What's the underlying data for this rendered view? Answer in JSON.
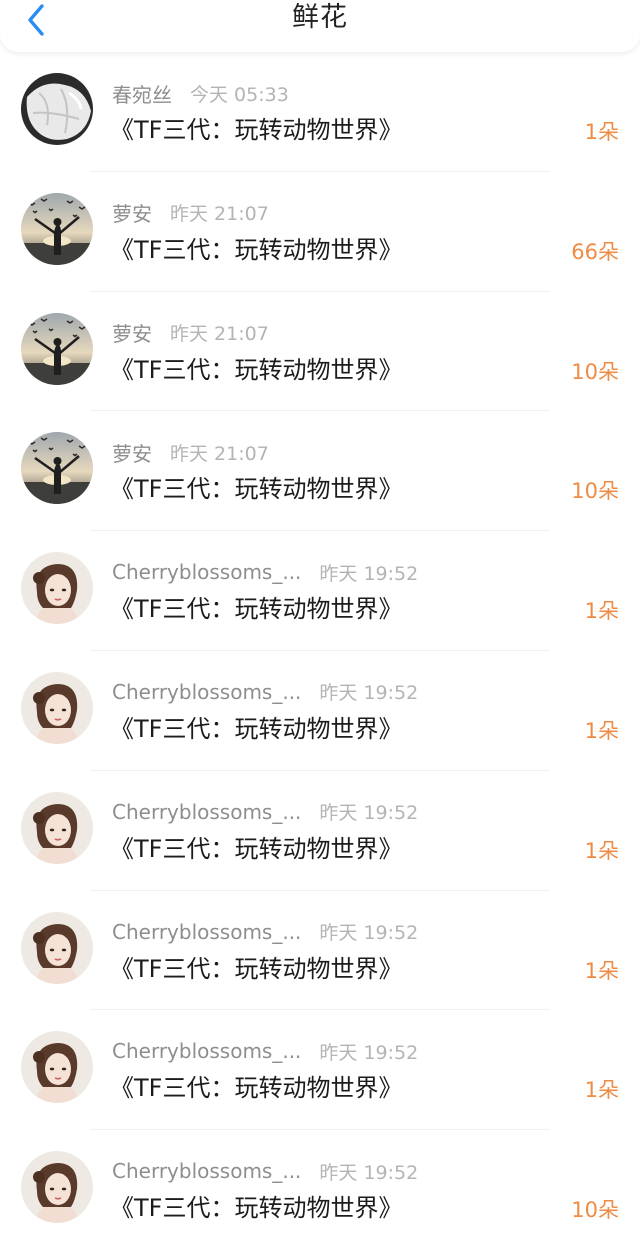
{
  "header": {
    "title": "鲜花",
    "back_icon": "chevron-left-icon",
    "accent": "#2b8cf2"
  },
  "colors": {
    "count": "#ef8b43",
    "username": "#8e8e8e",
    "time": "#b4b4b4"
  },
  "items": [
    {
      "user": "春宛丝",
      "time": "今天 05:33",
      "title": "《TF三代：玩转动物世界》",
      "count": "1朵",
      "avatar": "white-cloth"
    },
    {
      "user": "萝安",
      "time": "昨天 21:07",
      "title": "《TF三代：玩转动物世界》",
      "count": "66朵",
      "avatar": "sunset-birds"
    },
    {
      "user": "萝安",
      "time": "昨天 21:07",
      "title": "《TF三代：玩转动物世界》",
      "count": "10朵",
      "avatar": "sunset-birds"
    },
    {
      "user": "萝安",
      "time": "昨天 21:07",
      "title": "《TF三代：玩转动物世界》",
      "count": "10朵",
      "avatar": "sunset-birds"
    },
    {
      "user": "Cherryblossoms_...",
      "time": "昨天 19:52",
      "title": "《TF三代：玩转动物世界》",
      "count": "1朵",
      "avatar": "girl-portrait"
    },
    {
      "user": "Cherryblossoms_...",
      "time": "昨天 19:52",
      "title": "《TF三代：玩转动物世界》",
      "count": "1朵",
      "avatar": "girl-portrait"
    },
    {
      "user": "Cherryblossoms_...",
      "time": "昨天 19:52",
      "title": "《TF三代：玩转动物世界》",
      "count": "1朵",
      "avatar": "girl-portrait"
    },
    {
      "user": "Cherryblossoms_...",
      "time": "昨天 19:52",
      "title": "《TF三代：玩转动物世界》",
      "count": "1朵",
      "avatar": "girl-portrait"
    },
    {
      "user": "Cherryblossoms_...",
      "time": "昨天 19:52",
      "title": "《TF三代：玩转动物世界》",
      "count": "1朵",
      "avatar": "girl-portrait"
    },
    {
      "user": "Cherryblossoms_...",
      "time": "昨天 19:52",
      "title": "《TF三代：玩转动物世界》",
      "count": "10朵",
      "avatar": "girl-portrait"
    }
  ]
}
